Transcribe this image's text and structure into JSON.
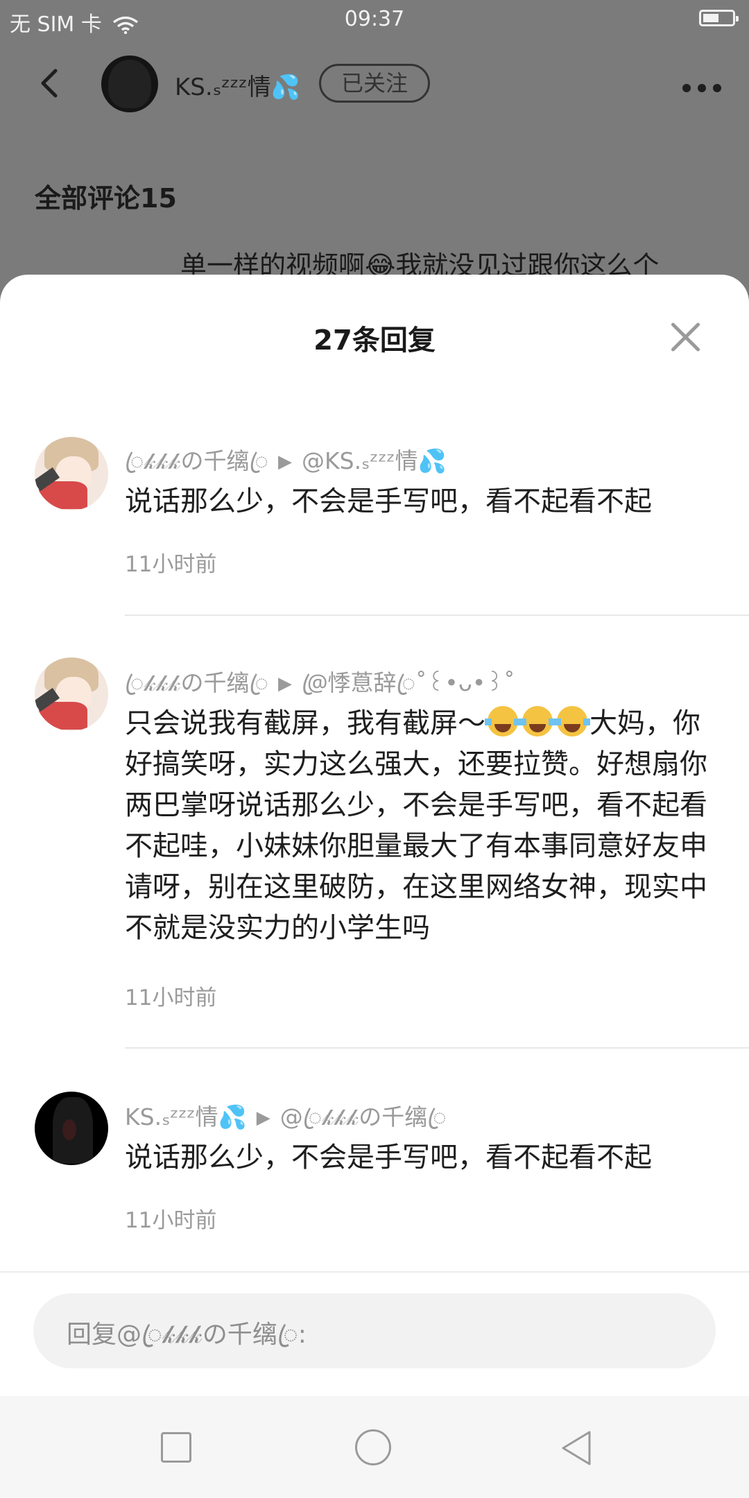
{
  "status_bar": {
    "carrier": "无 SIM 卡",
    "time": "09:37"
  },
  "header": {
    "username": "KS.ₛᶻᶻᶻ情💦",
    "follow_label": "已关注"
  },
  "background": {
    "all_comments_label": "全部评论15",
    "partial_text": "单一样的视频啊😂我就没见过跟你这么个"
  },
  "sheet": {
    "title": "27条回复",
    "replies": [
      {
        "author": "ꦿ𝓀𝓀𝓀の千缡ꦿ",
        "reply_to": "@KS.ₛᶻᶻᶻ情💦",
        "text": "说话那么少，不会是手写吧，看不起看不起",
        "time": "11小时前"
      },
      {
        "author": "ꦿ𝓀𝓀𝓀の千缡ꦿ",
        "reply_to": "@ꦿ悸蒠辞ꦿ˚꒰•ᴗ•꒱˚",
        "text_before_emoji": "只会说我有截屏，我有截屏～",
        "text_after_emoji": "大妈，你好搞笑呀，实力这么强大，还要拉赞。好想扇你两巴掌呀说话那么少，不会是手写吧，看不起看不起哇，小妹妹你胆量最大了有本事同意好友申请呀，别在这里破防，在这里网络女神，现实中不就是没实力的小学生吗",
        "time": "11小时前"
      },
      {
        "author": "KS.ₛᶻᶻᶻ情💦",
        "reply_to": "@ꦿ𝓀𝓀𝓀の千缡ꦿ",
        "text": "说话那么少，不会是手写吧，看不起看不起",
        "time": "11小时前"
      }
    ],
    "composer_placeholder": "回复@ꦿ𝓀𝓀𝓀の千缡ꦿ:"
  },
  "icons": [
    "wifi-icon",
    "battery-icon",
    "back-icon",
    "more-icon",
    "close-icon",
    "nav-recent-icon",
    "nav-home-icon",
    "nav-back-icon"
  ]
}
